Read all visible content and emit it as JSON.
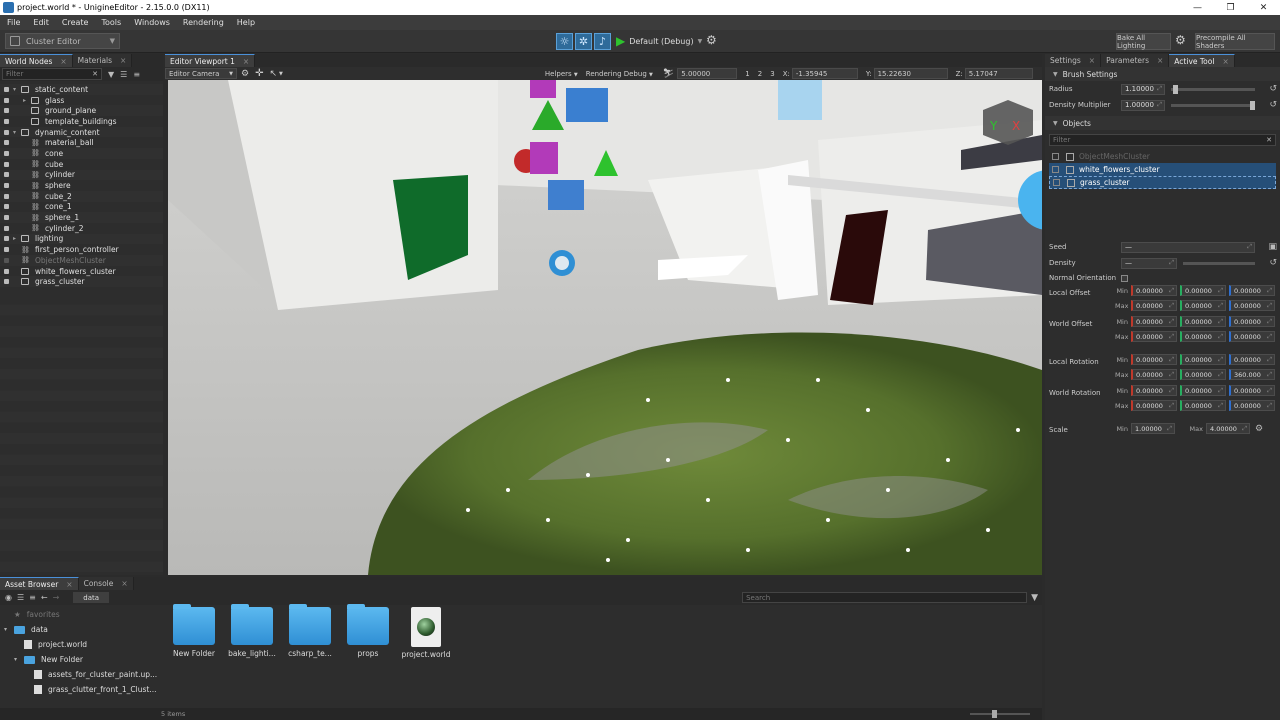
{
  "window": {
    "title": "project.world * - UnigineEditor - 2.15.0.0 (DX11)",
    "controls": [
      "—",
      "❐",
      "✕"
    ]
  },
  "menu": [
    "File",
    "Edit",
    "Create",
    "Tools",
    "Windows",
    "Rendering",
    "Help"
  ],
  "toolbar": {
    "tool_combo": "Cluster Editor",
    "run_config": "Default (Debug)",
    "bake_label": "Bake All Lighting",
    "precompile_label": "Precompile All Shaders"
  },
  "world_panel": {
    "tabs": [
      "World Nodes",
      "Materials"
    ],
    "filter_placeholder": "Filter",
    "nodes": [
      {
        "label": "static_content",
        "kind": "group",
        "indent": 0,
        "expand": "▾"
      },
      {
        "label": "glass",
        "kind": "node",
        "indent": 1,
        "expand": "▸"
      },
      {
        "label": "ground_plane",
        "kind": "node",
        "indent": 1,
        "expand": ""
      },
      {
        "label": "template_buildings",
        "kind": "node",
        "indent": 1,
        "expand": ""
      },
      {
        "label": "dynamic_content",
        "kind": "group",
        "indent": 0,
        "expand": "▾"
      },
      {
        "label": "material_ball",
        "kind": "ref",
        "indent": 1,
        "expand": ""
      },
      {
        "label": "cone",
        "kind": "ref",
        "indent": 1,
        "expand": ""
      },
      {
        "label": "cube",
        "kind": "ref",
        "indent": 1,
        "expand": ""
      },
      {
        "label": "cylinder",
        "kind": "ref",
        "indent": 1,
        "expand": ""
      },
      {
        "label": "sphere",
        "kind": "ref",
        "indent": 1,
        "expand": ""
      },
      {
        "label": "cube_2",
        "kind": "ref",
        "indent": 1,
        "expand": ""
      },
      {
        "label": "cone_1",
        "kind": "ref",
        "indent": 1,
        "expand": ""
      },
      {
        "label": "sphere_1",
        "kind": "ref",
        "indent": 1,
        "expand": ""
      },
      {
        "label": "cylinder_2",
        "kind": "ref",
        "indent": 1,
        "expand": ""
      },
      {
        "label": "lighting",
        "kind": "group",
        "indent": 0,
        "expand": "▸"
      },
      {
        "label": "first_person_controller",
        "kind": "ref",
        "indent": 0,
        "expand": ""
      },
      {
        "label": "ObjectMeshCluster",
        "kind": "ref",
        "indent": 0,
        "expand": "",
        "dim": true
      },
      {
        "label": "white_flowers_cluster",
        "kind": "node",
        "indent": 0,
        "expand": ""
      },
      {
        "label": "grass_cluster",
        "kind": "node",
        "indent": 0,
        "expand": ""
      }
    ]
  },
  "viewport": {
    "tab": "Editor Viewport 1",
    "camera": "Editor Camera",
    "helpers": "Helpers",
    "rendering_debug": "Rendering Debug",
    "speed": "5.00000",
    "layouts": [
      "1",
      "2",
      "3"
    ],
    "x": "-1.35945",
    "y": "15.22630",
    "z": "5.17047",
    "x_label": "X:",
    "y_label": "Y:",
    "z_label": "Z:"
  },
  "right_panel": {
    "tabs": [
      "Settings",
      "Parameters",
      "Active Tool"
    ],
    "brush": {
      "title": "Brush Settings",
      "radius_label": "Radius",
      "radius": "1.10000",
      "radius_level": 0.02,
      "density_label": "Density Multiplier",
      "density": "1.00000",
      "density_level": 1.0
    },
    "objects": {
      "title": "Objects",
      "filter_placeholder": "Filter",
      "items": [
        {
          "label": "ObjectMeshCluster",
          "state": "disabled"
        },
        {
          "label": "white_flowers_cluster",
          "state": "selected"
        },
        {
          "label": "grass_cluster",
          "state": "focused"
        }
      ]
    },
    "seed_label": "Seed",
    "seed": "—",
    "density_label": "Density",
    "density": "—",
    "normal_orientation_label": "Normal Orientation",
    "min_label": "Min",
    "max_label": "Max",
    "local_offset_label": "Local Offset",
    "local_offset": {
      "min": [
        "0.00000",
        "0.00000",
        "0.00000"
      ],
      "max": [
        "0.00000",
        "0.00000",
        "0.00000"
      ]
    },
    "world_offset_label": "World Offset",
    "world_offset": {
      "min": [
        "0.00000",
        "0.00000",
        "0.00000"
      ],
      "max": [
        "0.00000",
        "0.00000",
        "0.00000"
      ]
    },
    "local_rotation_label": "Local Rotation",
    "local_rotation": {
      "min": [
        "0.00000",
        "0.00000",
        "0.00000"
      ],
      "max": [
        "0.00000",
        "0.00000",
        "360.000"
      ]
    },
    "world_rotation_label": "World Rotation",
    "world_rotation": {
      "min": [
        "0.00000",
        "0.00000",
        "0.00000"
      ],
      "max": [
        "0.00000",
        "0.00000",
        "0.00000"
      ]
    },
    "scale_label": "Scale",
    "scale_min": "1.00000",
    "scale_max": "4.00000"
  },
  "asset_browser": {
    "tabs": [
      "Asset Browser",
      "Console"
    ],
    "breadcrumb": "data",
    "search_placeholder": "Search",
    "tree": [
      {
        "label": "favorites",
        "icon": "star",
        "indent": 0,
        "expand": ""
      },
      {
        "label": "data",
        "icon": "folder",
        "indent": 0,
        "expand": "▾"
      },
      {
        "label": "project.world",
        "icon": "doc",
        "indent": 1,
        "expand": ""
      },
      {
        "label": "New Folder",
        "icon": "folder",
        "indent": 1,
        "expand": "▾"
      },
      {
        "label": "assets_for_cluster_paint.up...",
        "icon": "doc",
        "indent": 2,
        "expand": ""
      },
      {
        "label": "grass_clutter_front_1_Clust...",
        "icon": "doc",
        "indent": 2,
        "expand": ""
      }
    ],
    "items": [
      {
        "label": "New Folder",
        "type": "folder"
      },
      {
        "label": "bake_lighti...",
        "type": "folder"
      },
      {
        "label": "csharp_te...",
        "type": "folder"
      },
      {
        "label": "props",
        "type": "folder"
      },
      {
        "label": "project.world",
        "type": "world"
      }
    ],
    "status": "5 items"
  },
  "colors": {
    "accent": "#4a90d9",
    "selection": "#264f78",
    "play": "#2ec22e"
  }
}
